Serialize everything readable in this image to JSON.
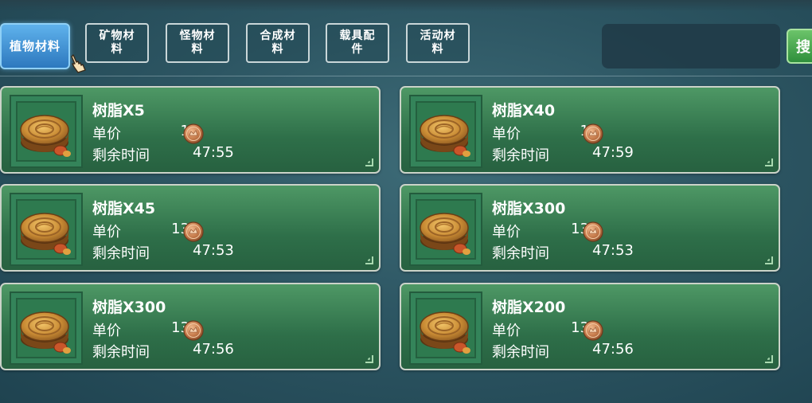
{
  "tabs": [
    {
      "label": "植物材料",
      "active": true
    },
    {
      "label": "矿物材料",
      "active": false
    },
    {
      "label": "怪物材料",
      "active": false
    },
    {
      "label": "合成材料",
      "active": false
    },
    {
      "label": "载具配件",
      "active": false
    },
    {
      "label": "活动材料",
      "active": false
    }
  ],
  "search": {
    "button_label": "搜"
  },
  "labels": {
    "unit_price": "单价",
    "time_left": "剩余时间"
  },
  "listings": [
    {
      "name": "树脂X5",
      "price": "1",
      "time": "47:55"
    },
    {
      "name": "树脂X40",
      "price": "1",
      "time": "47:59"
    },
    {
      "name": "树脂X45",
      "price": "13",
      "time": "47:53"
    },
    {
      "name": "树脂X300",
      "price": "13",
      "time": "47:53"
    },
    {
      "name": "树脂X300",
      "price": "13",
      "time": "47:56"
    },
    {
      "name": "树脂X200",
      "price": "13",
      "time": "47:56"
    }
  ],
  "icons": {
    "item": "resin-icon",
    "currency": "copper-coin-icon",
    "cursor": "pointing-hand-icon"
  },
  "colors": {
    "active_tab": "#3a8ed4",
    "card": "#3f8a5a",
    "search_button": "#4cae52"
  }
}
